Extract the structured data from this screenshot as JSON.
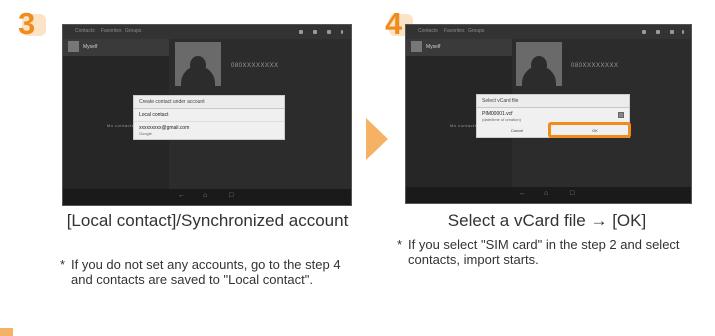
{
  "steps": [
    {
      "number": "3",
      "screen": {
        "topbar_tabs": [
          "Contacts",
          "Favorites",
          "Groups"
        ],
        "list_item": "Myself",
        "phone_placeholder": "080XXXXXXXX",
        "side_label": "Mo contacts",
        "dialog": {
          "title": "Create contact under account",
          "items": [
            {
              "label": "Local contact",
              "sub": ""
            },
            {
              "label": "xxxxxxxxx@gmail.com",
              "sub": "Google"
            }
          ]
        }
      },
      "caption": "[Local contact]/Synchronized account",
      "note": "If you do not set any accounts, go to the step 4 and contacts are saved to \"Local contact\"."
    },
    {
      "number": "4",
      "screen": {
        "topbar_tabs": [
          "Contacts",
          "Favorites",
          "Groups"
        ],
        "list_item": "Myself",
        "phone_placeholder": "080XXXXXXXX",
        "side_label": "Mo contacts",
        "dialog": {
          "title": "Select vCard file",
          "items": [
            {
              "label": "PIM00001.vcf",
              "sub": "(date/time of creation)"
            }
          ],
          "cancel_label": "Cancel",
          "ok_label": "OK"
        }
      },
      "caption": "Select a vCard file → [OK]",
      "note": "If you select \"SIM card\" in the step 2 and select contacts, import starts."
    }
  ],
  "note_marker": "*",
  "colors": {
    "accent": "#f08c1e",
    "arrow": "#f5b264"
  }
}
